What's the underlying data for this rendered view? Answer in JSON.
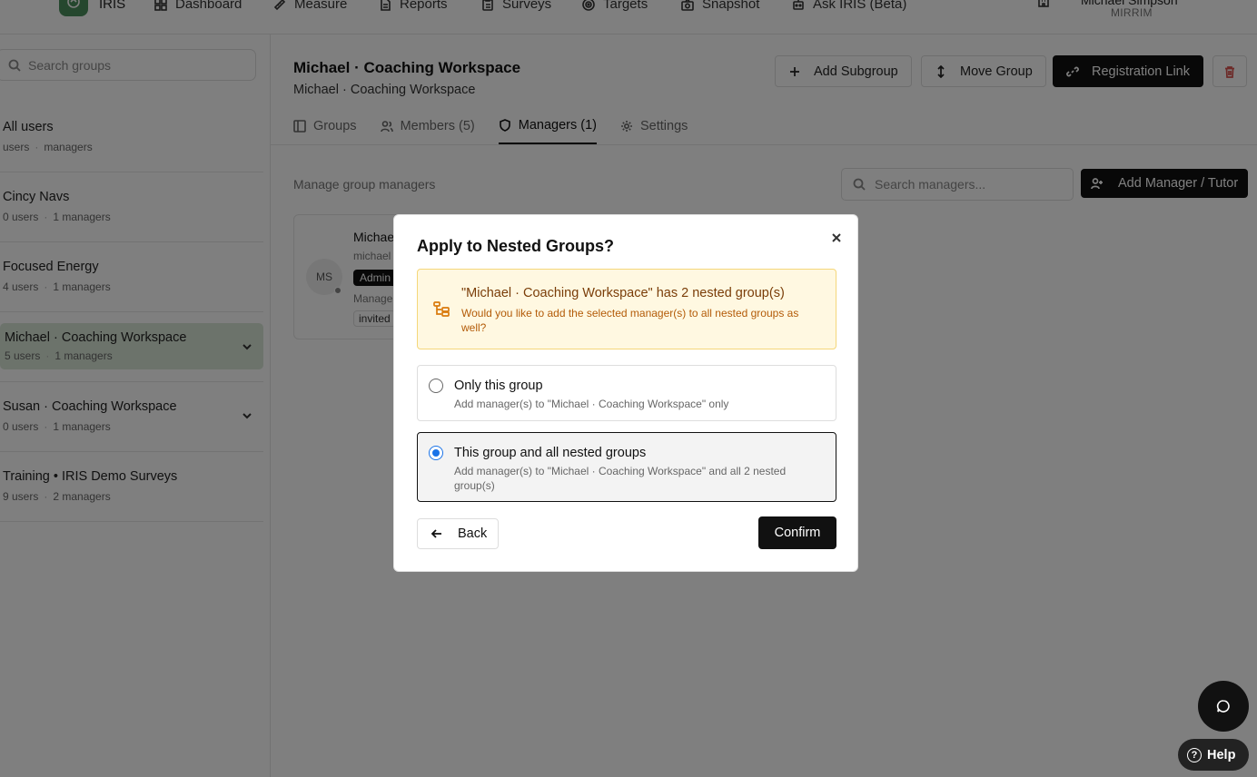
{
  "nav": {
    "brand": "IRIS",
    "items": [
      {
        "label": "Dashboard",
        "icon": "grid-icon"
      },
      {
        "label": "Measure",
        "icon": "ruler-icon"
      },
      {
        "label": "Reports",
        "icon": "file-icon"
      },
      {
        "label": "Surveys",
        "icon": "clipboard-icon"
      },
      {
        "label": "Targets",
        "icon": "target-icon"
      },
      {
        "label": "Snapshot",
        "icon": "camera-icon"
      },
      {
        "label": "Ask IRIS (Beta)",
        "icon": "bot-icon"
      }
    ],
    "user_name": "Michael Simpson",
    "user_org": "MIRRIM"
  },
  "sidebar": {
    "search_placeholder": "Search groups",
    "groups": [
      {
        "name": "All users",
        "users": "users",
        "managers": "managers"
      },
      {
        "name": "Cincy Navs",
        "users": "0 users",
        "managers": "1 managers"
      },
      {
        "name": "Focused Energy",
        "users": "4 users",
        "managers": "1 managers"
      },
      {
        "name": "Michael · Coaching Workspace",
        "users": "5 users",
        "managers": "1 managers"
      },
      {
        "name": "Susan · Coaching Workspace",
        "users": "0 users",
        "managers": "1 managers"
      },
      {
        "name": "Training • IRIS Demo Surveys",
        "users": "9 users",
        "managers": "2 managers"
      }
    ]
  },
  "main": {
    "title": "Michael · Coaching Workspace",
    "subtitle": "Michael · Coaching Workspace",
    "actions": {
      "add_subgroup": "Add Subgroup",
      "move_group": "Move Group",
      "registration_link": "Registration Link"
    },
    "tabs": [
      {
        "label": "Groups"
      },
      {
        "label": "Members (5)"
      },
      {
        "label": "Managers (1)"
      },
      {
        "label": "Settings"
      }
    ],
    "manage_label": "Manage group managers",
    "search_managers_placeholder": "Search managers...",
    "add_manager_label": "Add Manager / Tutor",
    "manager_card": {
      "initials": "MS",
      "name": "Michae",
      "email": "michael",
      "role": "Admin",
      "managed": "Manage",
      "status": "invited"
    }
  },
  "modal": {
    "title": "Apply to Nested Groups?",
    "warning_title": "\"Michael · Coaching Workspace\" has 2 nested group(s)",
    "warning_desc": "Would you like to add the selected manager(s) to all nested groups as well?",
    "option1_title": "Only this group",
    "option1_desc": "Add manager(s) to \"Michael · Coaching Workspace\" only",
    "option2_title": "This group and all nested groups",
    "option2_desc": "Add manager(s) to \"Michael · Coaching Workspace\" and all 2 nested group(s)",
    "selected_option": "option2",
    "back_label": "Back",
    "confirm_label": "Confirm"
  },
  "help_label": "Help",
  "colors": {
    "accent": "#111111",
    "active_group": "#d8e6d7",
    "warning_bg": "#fff8e1",
    "warning_text": "#b35b08",
    "radio": "#1a73e8",
    "logo": "#4a8f5c"
  }
}
